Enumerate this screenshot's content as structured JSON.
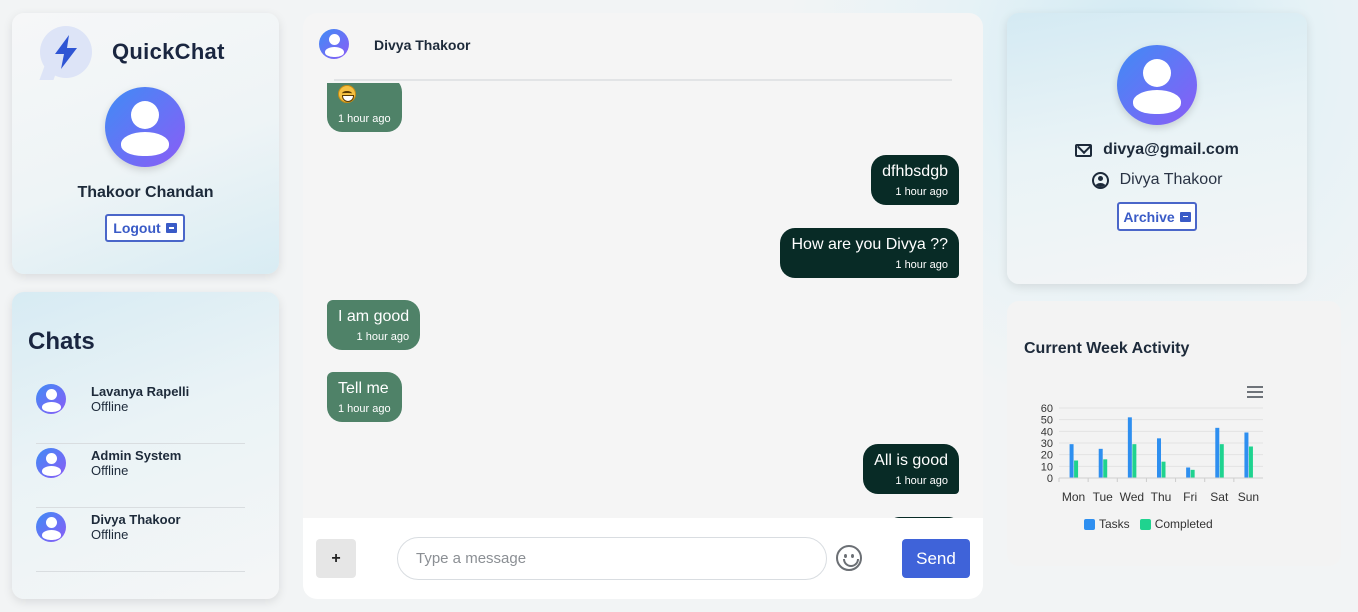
{
  "app": {
    "name": "QuickChat"
  },
  "me": {
    "name": "Thakoor Chandan",
    "logout_label": "Logout"
  },
  "chats": {
    "title": "Chats",
    "items": [
      {
        "name": "Lavanya Rapelli",
        "status": "Offline"
      },
      {
        "name": "Admin System",
        "status": "Offline"
      },
      {
        "name": "Divya Thakoor",
        "status": "Offline"
      }
    ]
  },
  "conversation": {
    "contact_name": "Divya Thakoor",
    "messages": [
      {
        "direction": "in",
        "text": "😄",
        "time": "1 hour ago"
      },
      {
        "direction": "out",
        "text": "dfhbsdgb",
        "time": "1 hour ago"
      },
      {
        "direction": "out",
        "text": "How are you Divya ??",
        "time": "1 hour ago"
      },
      {
        "direction": "in",
        "text": "I am good",
        "time": "1 hour ago"
      },
      {
        "direction": "in",
        "text": "Tell me",
        "time": "1 hour ago"
      },
      {
        "direction": "out",
        "text": "All is good",
        "time": "1 hour ago"
      }
    ]
  },
  "composer": {
    "attach_label": "+",
    "placeholder": "Type a message",
    "send_label": "Send"
  },
  "contact": {
    "email": "divya@gmail.com",
    "name": "Divya Thakoor",
    "archive_label": "Archive"
  },
  "activity": {
    "title": "Current Week Activity"
  },
  "colors": {
    "incoming": "#4f8268",
    "outgoing": "#082b26",
    "accent": "#3f63d9",
    "tasks": "#2e8ff0",
    "completed": "#1fd38f"
  },
  "chart_data": {
    "type": "bar",
    "categories": [
      "Mon",
      "Tue",
      "Wed",
      "Thu",
      "Fri",
      "Sat",
      "Sun"
    ],
    "series": [
      {
        "name": "Tasks",
        "values": [
          29,
          25,
          52,
          34,
          9,
          43,
          39
        ]
      },
      {
        "name": "Completed",
        "values": [
          15,
          16,
          29,
          14,
          7,
          29,
          27
        ]
      }
    ],
    "yticks": [
      0,
      10,
      20,
      30,
      40,
      50,
      60
    ],
    "ylim": [
      0,
      60
    ],
    "legend": "bottom",
    "grid": true
  }
}
